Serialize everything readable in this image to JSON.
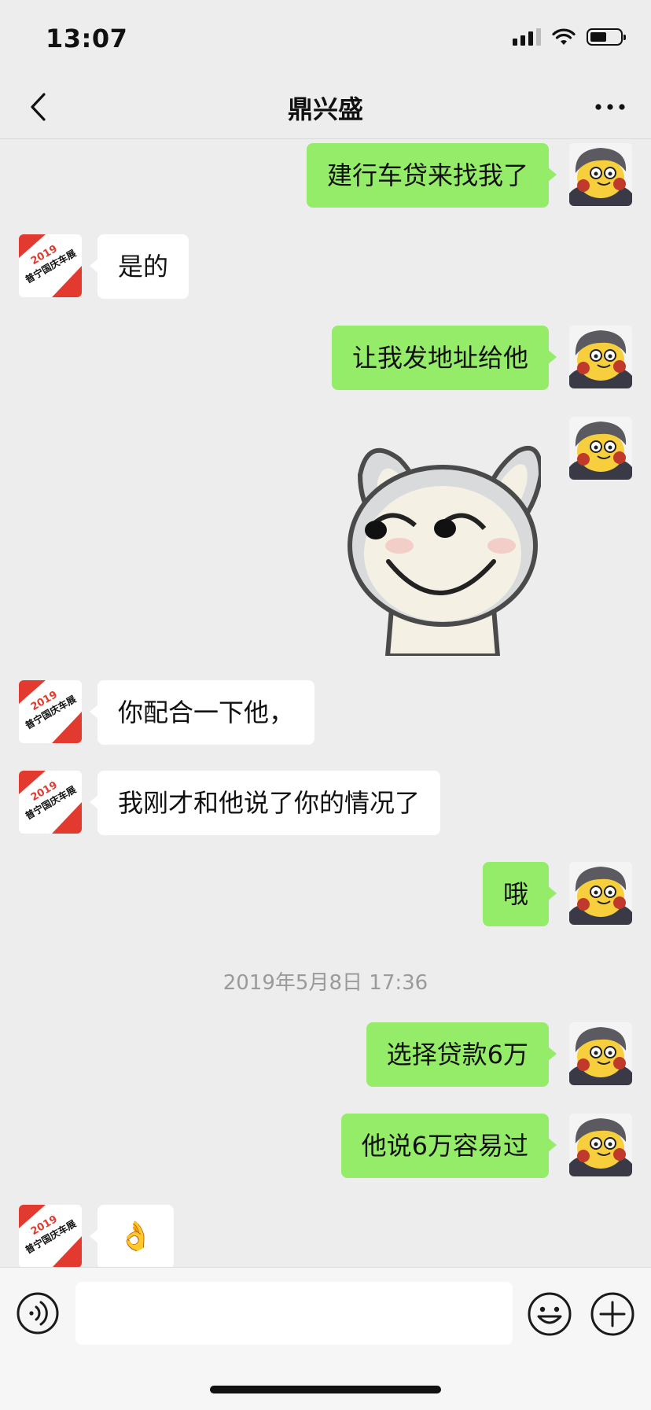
{
  "status_bar": {
    "time": "13:07",
    "battery_level": 0.55
  },
  "header": {
    "title": "鼎兴盛"
  },
  "messages": [
    {
      "side": "me",
      "text": "建行车贷来找我了"
    },
    {
      "side": "other",
      "text": "是的"
    },
    {
      "side": "me",
      "text": "让我发地址给他"
    },
    {
      "side": "me",
      "type": "sticker",
      "sticker": "smirking-rabbit-sticker"
    },
    {
      "side": "other",
      "text": "你配合一下他，"
    },
    {
      "side": "other",
      "text": "我刚才和他说了你的情况了"
    },
    {
      "side": "me",
      "text": "哦"
    },
    {
      "type": "timestamp",
      "text": "2019年5月8日 17:36"
    },
    {
      "side": "me",
      "text": "选择贷款6万"
    },
    {
      "side": "me",
      "text": "他说6万容易过"
    },
    {
      "side": "other",
      "type": "emoji",
      "text": "👌"
    }
  ],
  "other_avatar": {
    "line1": "2019",
    "line2": "普宁国庆车展"
  },
  "input": {
    "value": "",
    "placeholder": ""
  },
  "colors": {
    "my_bubble": "#95EC69",
    "other_bubble": "#FFFFFF",
    "background": "#EDEDED"
  }
}
